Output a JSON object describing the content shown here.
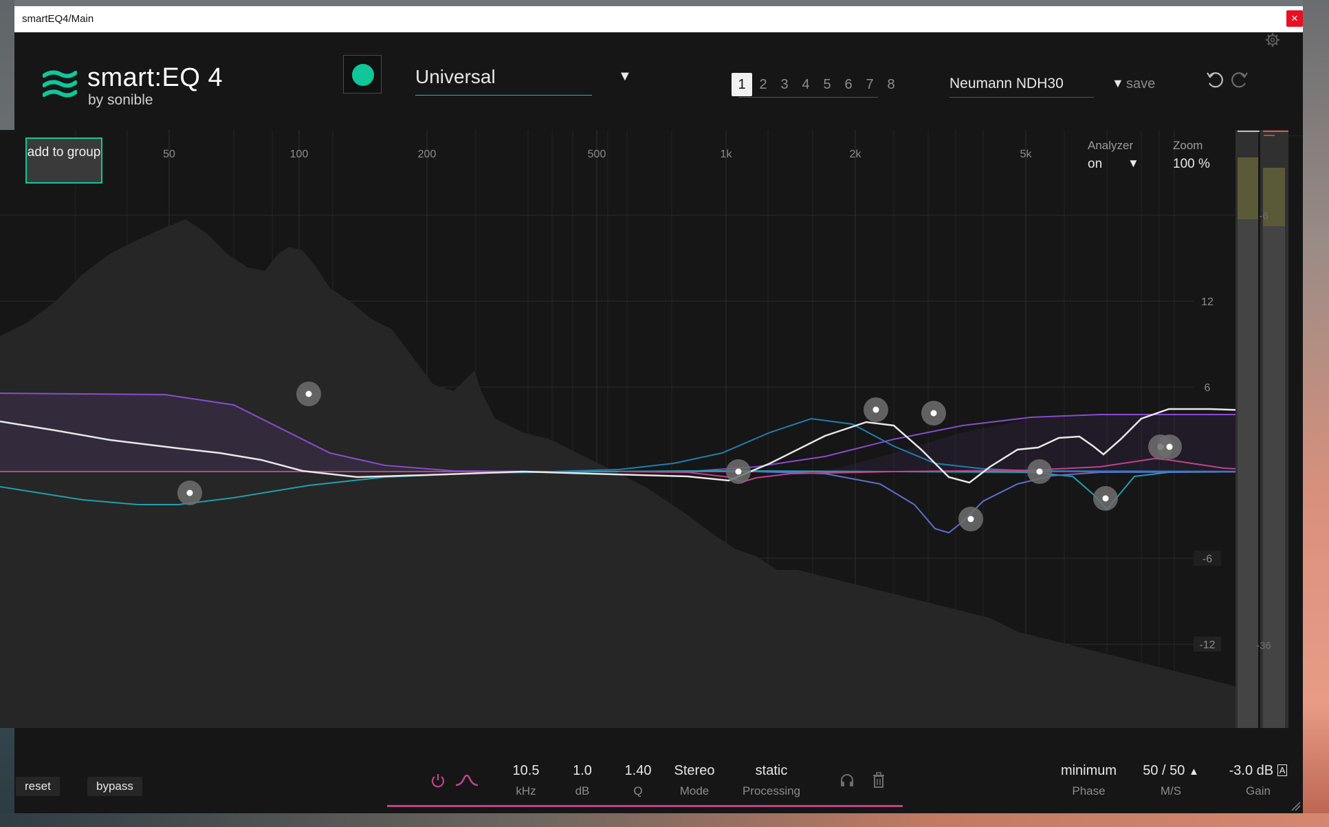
{
  "window": {
    "title": "smartEQ4/Main",
    "close_label": "×"
  },
  "header": {
    "brand": "smart:EQ 4",
    "byline": "by sonible",
    "profile": {
      "value": "Universal"
    },
    "groups": [
      "1",
      "2",
      "3",
      "4",
      "5",
      "6",
      "7",
      "8"
    ],
    "active_group": "1",
    "device": {
      "value": "Neumann NDH30"
    },
    "save_label": "save"
  },
  "plot": {
    "add_group_label": "add to group",
    "freq_ticks": [
      "50",
      "100",
      "200",
      "500",
      "1k",
      "2k",
      "5k"
    ],
    "db_ticks": [
      "12",
      "6",
      "-6",
      "-12"
    ],
    "meter_ticks": [
      "-6",
      "-36"
    ],
    "analyzer": {
      "label": "Analyzer",
      "value": "on"
    },
    "zoom": {
      "label": "Zoom",
      "value": "100 %"
    }
  },
  "footer": {
    "reset_label": "reset",
    "bypass_label": "bypass",
    "freq": {
      "value": "10.5",
      "unit": "kHz"
    },
    "gain": {
      "value": "1.0",
      "unit": "dB"
    },
    "q": {
      "value": "1.40",
      "unit": "Q"
    },
    "mode": {
      "value": "Stereo",
      "label": "Mode"
    },
    "processing": {
      "value": "static",
      "label": "Processing"
    },
    "phase": {
      "value": "minimum",
      "label": "Phase"
    },
    "ms": {
      "value": "50 / 50",
      "label": "M/S"
    },
    "output_gain": {
      "value": "-3.0 dB",
      "label": "Gain",
      "badge": "A"
    }
  },
  "colors": {
    "accent": "#11c79a",
    "pink": "#c3428a",
    "purple": "#8a4ccf",
    "teal": "#1f9fb0",
    "blue": "#5a6fd0"
  }
}
